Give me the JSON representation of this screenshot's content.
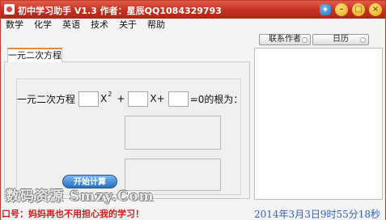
{
  "window": {
    "title": "初中学习助手  V1.3   作者：星辰QQ1084329793"
  },
  "menu": {
    "items": [
      "数学",
      "化学",
      "英语",
      "技术",
      "关于",
      "帮助"
    ]
  },
  "top_buttons": {
    "contact_label": "联系作者",
    "calendar_label": "日历"
  },
  "tab": {
    "label": "一元二次方程"
  },
  "equation": {
    "prefix": "一元二次方程",
    "x2_symbol": "X",
    "x2_superscript": "2",
    "plus1": "+",
    "x_symbol": "X+",
    "suffix": "=0的根为：",
    "coef_a": "",
    "coef_b": "",
    "coef_c": ""
  },
  "calc_button": {
    "label": "开始计算"
  },
  "watermark": {
    "text": "数码资源 Smzy.Com"
  },
  "status": {
    "left_text": "口号：妈妈再也不用担心我的学习！",
    "right_text": "2014年3月3日9时55分18秒"
  }
}
